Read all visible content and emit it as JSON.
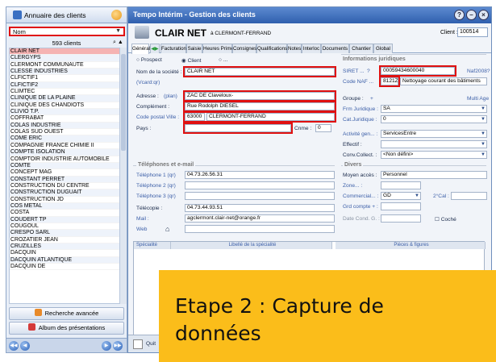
{
  "left_panel": {
    "title": "Annuaire des clients",
    "filter_value": "Nom",
    "count": "593 clients",
    "clients": [
      "CLAIR NET",
      "CLERGYPS",
      "CLERMONT COMMUNAUTE",
      "CLESSE INDUSTRIES",
      "CLFICTIF1",
      "CLFICTIF2",
      "CLIMTEC",
      "CLINIQUE DE LA PLAINE",
      "CLINIQUE DES CHANDIOTS",
      "CLIVIO T.P.",
      "COFFRABAT",
      "COLAS INDUSTRIE",
      "COLAS SUD OUEST",
      "COME ERIC",
      "COMPAGNIE FRANCE CHIMIE II",
      "COMPTE ISOLATION",
      "COMPTOIR INDUSTRIE AUTOMOBILE",
      "COMTE",
      "CONCEPT MAG",
      "CONSTANT PERRET",
      "CONSTRUCTION DU CENTRE",
      "CONSTRUCTION DUGUAIT",
      "CONSTRUCTION JD",
      "COS METAL",
      "COSTA",
      "COUDERT TP",
      "COUGOUL",
      "CRESPO SARL",
      "CROZATIER JEAN",
      "CRUZILLES",
      "DACQUIN",
      "DACQUIN ATLANTIQUE",
      "DACQUIN DE"
    ],
    "btn_search": "Recherche avancée",
    "btn_album": "Album des présentations"
  },
  "window": {
    "title": "Tempo Intérim - Gestion des clients",
    "client_name": "CLAIR NET",
    "client_city": "à CLERMONT-FERRAND",
    "client_label": "Client :",
    "client_id": "100514"
  },
  "tabs": [
    "Général",
    "Facturation",
    "Saisie",
    "Heures Primes",
    "Consignes",
    "Qualifications",
    "Notes",
    "Interloc",
    "Documents",
    "Chantier",
    "Global"
  ],
  "form": {
    "prospect": "Prospect",
    "client": "Client",
    "other": "...",
    "nom_label": "Nom de la société :",
    "nom_value": "CLAIR NET",
    "vcard": "(Vcard:qr)",
    "adresse_label": "Adresse :",
    "plan": "(plan)",
    "adresse_value": "ZAC DE Claveloux-",
    "complement_label": "Complément :",
    "complement_value": "Rue Rodolph DIESEL",
    "cp_label": "Code postal  Ville :",
    "cp_value": "63000",
    "ville_value": "CLERMONT-FERRAND",
    "pays_label": "Pays :",
    "cnme_label": "Cnme :",
    "cnme_value": "0"
  },
  "legal": {
    "section": "Informations juridiques",
    "siret_label": "SIRET ...",
    "siret_q": "?",
    "siret_value": "00059434600040",
    "naf2008": "Naf2008?",
    "naf_label": "Code NAF ...",
    "naf_value": "8121Z",
    "naf_desc": "Nettoyage courant des bâtiments",
    "groupe_label": "Groupe :",
    "groupe_plus": "+",
    "multi_age": "Multi Age",
    "frm_label": "Frm Juridique :",
    "frm_value": "SA",
    "cat_label": "Cat.Juridique :",
    "cat_value": "0",
    "activite_label": "Activité gen... :",
    "activite_value": "ServicesEntre",
    "effectif_label": "Effectif :",
    "conv_label": "Conv.Collect. :",
    "conv_value": "<Non défini>"
  },
  "phones": {
    "section": "Téléphones et e-mail",
    "tel1_label": "Téléphone 1",
    "tel1_value": "04.73.26.56.31",
    "tel2_label": "Téléphone 2",
    "tel3_label": "Téléphone 3",
    "qr": "(qr)",
    "fax_label": "Télécopie :",
    "fax_value": "04.73.44.93.51",
    "mail_label": "Mail :",
    "mail_value": "agclermont.clair-net@orange.fr",
    "web_label": "Web"
  },
  "divers": {
    "section": "Divers",
    "moyen_label": "Moyen accès :",
    "moyen_value": "Personnel",
    "zone_label": "Zone... :",
    "commercial_label": "Commercial... :",
    "commercial_value": "GD",
    "second": "2°Cal :",
    "grd_label": "Grd compte + :",
    "date_label": "Date Cond. G. :",
    "coche": "Coché"
  },
  "grid": {
    "col1": "Spécialité",
    "col2": "Libellé de la spécialité",
    "col3": "Pièces & figures"
  },
  "bottom": {
    "quit": "Quit"
  },
  "overlay": {
    "line1": "Etape 2 : Capture de",
    "line2": "données"
  },
  "colors": {
    "highlight": "#e01010",
    "overlay_bg": "#fbbd1a",
    "title_bar": "#2f5fae"
  }
}
